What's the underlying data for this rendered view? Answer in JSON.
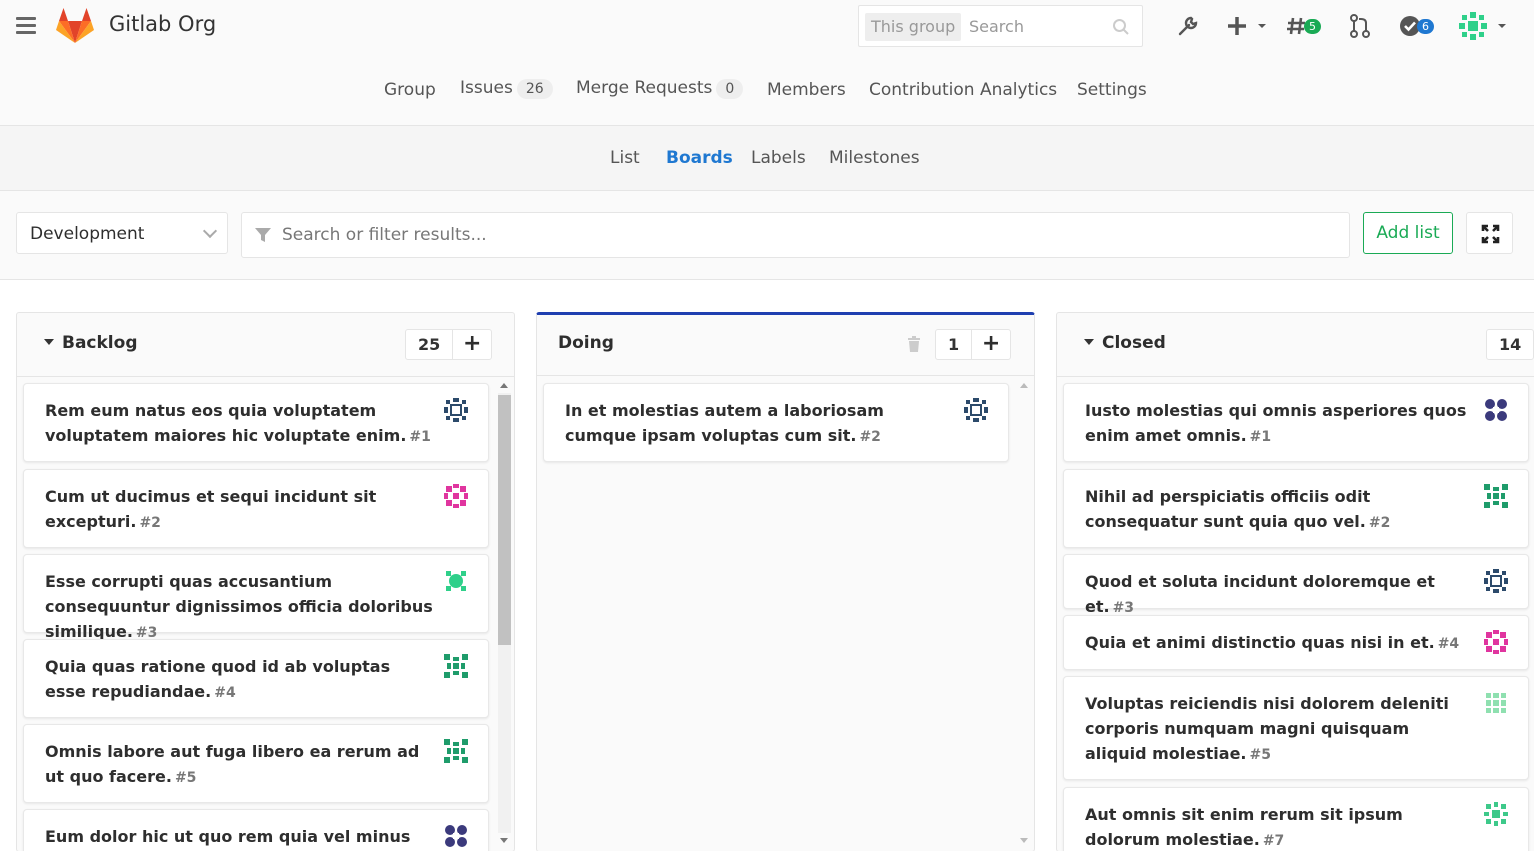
{
  "header": {
    "app_title": "Gitlab Org",
    "search_scope": "This group",
    "search_placeholder": "Search",
    "todo_count": "5",
    "issues_count": "6"
  },
  "group_nav": {
    "tabs": [
      {
        "label": "Group"
      },
      {
        "label": "Issues",
        "count": "26"
      },
      {
        "label": "Merge Requests",
        "count": "0"
      },
      {
        "label": "Members"
      },
      {
        "label": "Contribution Analytics"
      },
      {
        "label": "Settings"
      }
    ]
  },
  "sub_nav": {
    "tabs": [
      {
        "label": "List"
      },
      {
        "label": "Boards",
        "active": true
      },
      {
        "label": "Labels"
      },
      {
        "label": "Milestones"
      }
    ]
  },
  "filter_bar": {
    "board": "Development",
    "filter_placeholder": "Search or filter results...",
    "add_list_label": "Add list"
  },
  "lists": [
    {
      "title": "Backlog",
      "count": "25",
      "cards": [
        {
          "title": "Rem eum natus eos quia voluptatem voluptatem maiores hic voluptate enim.",
          "num": "#1",
          "avatar_color": "#2c4a6b"
        },
        {
          "title": "Cum ut ducimus et sequi incidunt sit excepturi.",
          "num": "#2",
          "avatar_color": "#e0359f"
        },
        {
          "title": "Esse corrupti quas accusantium consequuntur dignissimos officia doloribus similique.",
          "num": "#3",
          "avatar_color": "#2fd08a"
        },
        {
          "title": "Quia quas ratione quod id ab voluptas esse repudiandae.",
          "num": "#4",
          "avatar_color": "#1f9c6b"
        },
        {
          "title": "Omnis labore aut fuga libero ea rerum ad ut quo facere.",
          "num": "#5",
          "avatar_color": "#1f9c6b"
        },
        {
          "title": "Eum dolor hic ut quo rem quia vel minus",
          "num": "",
          "avatar_color": "#3b3a7c"
        }
      ]
    },
    {
      "title": "Doing",
      "count": "1",
      "cards": [
        {
          "title": "In et molestias autem a laboriosam cumque ipsam voluptas cum sit.",
          "num": "#2",
          "avatar_color": "#2c4a6b"
        }
      ]
    },
    {
      "title": "Closed",
      "count": "14",
      "cards": [
        {
          "title": "Iusto molestias qui omnis asperiores quos enim amet omnis.",
          "num": "#1",
          "avatar_color": "#3b3a7c"
        },
        {
          "title": "Nihil ad perspiciatis officiis odit consequatur sunt quia quo vel.",
          "num": "#2",
          "avatar_color": "#1f9c6b"
        },
        {
          "title": "Quod et soluta incidunt doloremque et et.",
          "num": "#3",
          "avatar_color": "#2c4a6b"
        },
        {
          "title": "Quia et animi distinctio quas nisi in et.",
          "num": "#4",
          "avatar_color": "#e0359f"
        },
        {
          "title": "Voluptas reiciendis nisi dolorem deleniti corporis numquam magni quisquam aliquid molestiae.",
          "num": "#5",
          "avatar_color": "#8fe0b0"
        },
        {
          "title": "Aut omnis sit enim rerum sit ipsum dolorum molestiae.",
          "num": "#7",
          "avatar_color": "#3dc98a"
        }
      ]
    }
  ]
}
